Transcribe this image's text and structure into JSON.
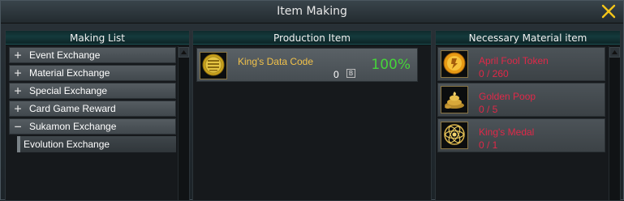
{
  "window": {
    "title": "Item Making"
  },
  "making_list": {
    "header": "Making List",
    "items": [
      {
        "icon": "+",
        "label": "Event Exchange"
      },
      {
        "icon": "+",
        "label": "Material Exchange"
      },
      {
        "icon": "+",
        "label": "Special Exchange"
      },
      {
        "icon": "+",
        "label": "Card Game Reward"
      },
      {
        "icon": "−",
        "label": "Sukamon Exchange"
      }
    ],
    "sub_items": [
      {
        "label": "Evolution Exchange"
      }
    ]
  },
  "production": {
    "header": "Production Item",
    "item": {
      "name": "King's Data Code",
      "percent": "100%",
      "count": "0",
      "bind_badge": "B",
      "icon": "data-code-coin-icon"
    }
  },
  "materials": {
    "header": "Necessary Material item",
    "items": [
      {
        "name": "April Fool Token",
        "qty": "0 / 260",
        "icon": "april-fool-token-icon"
      },
      {
        "name": "Golden Poop",
        "qty": "0 / 5",
        "icon": "golden-poop-icon"
      },
      {
        "name": "King's Medal",
        "qty": "0 / 1",
        "icon": "kings-medal-icon"
      }
    ]
  },
  "colors": {
    "gold": "#f2c24a",
    "percent_green": "#45d43a",
    "missing_red": "#e02848",
    "close_x": "#f5c518"
  }
}
